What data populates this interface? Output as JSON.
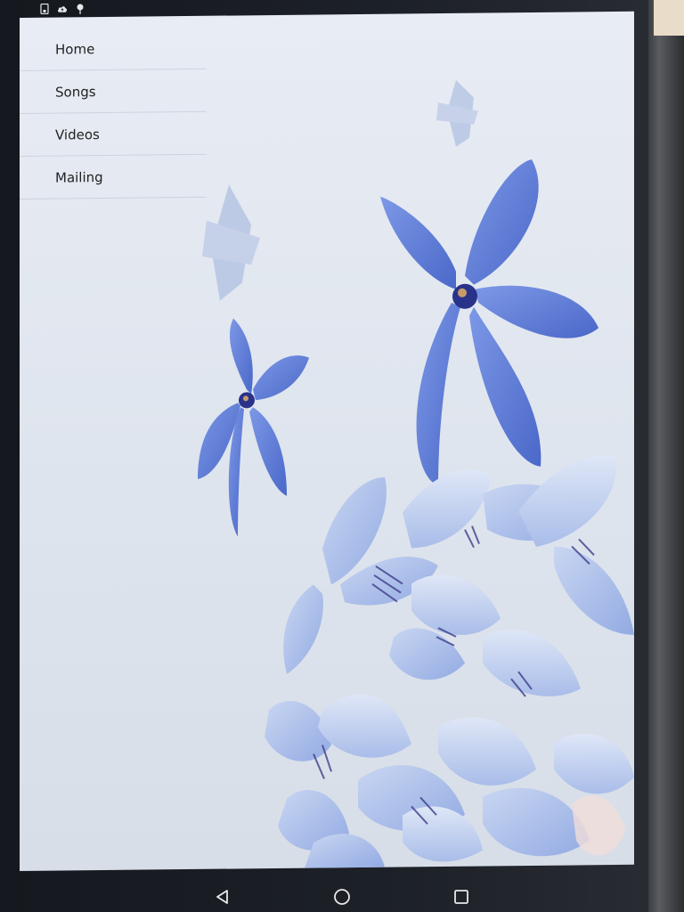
{
  "menu": {
    "items": [
      {
        "label": "Home"
      },
      {
        "label": "Songs"
      },
      {
        "label": "Videos"
      },
      {
        "label": "Mailing"
      }
    ]
  },
  "status_icons": [
    "sim-card-icon",
    "cloud-upload-icon",
    "location-pin-icon"
  ],
  "nav": [
    "back-icon",
    "home-icon",
    "recents-icon"
  ],
  "colors": {
    "flower_blue": "#5b7fd6",
    "flower_dark": "#2f3f9a",
    "background": "#e3e8f0"
  }
}
